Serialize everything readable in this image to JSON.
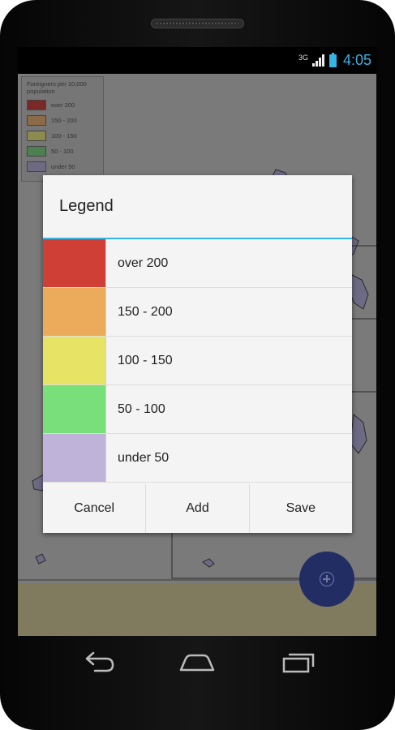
{
  "status_bar": {
    "network": "3G",
    "time": "4:05",
    "icons": [
      "signal-icon",
      "battery-icon"
    ],
    "accent_color": "#33b5e5"
  },
  "map_legend": {
    "title": "Foreigners per 10,000 population",
    "items": [
      {
        "label": "over 200",
        "color": "#7a2a26"
      },
      {
        "label": "150 - 200",
        "color": "#8a6a47"
      },
      {
        "label": "100 - 150",
        "color": "#8c8a4e"
      },
      {
        "label": "50 - 100",
        "color": "#4c8050"
      },
      {
        "label": "under 50",
        "color": "#6d6a83"
      }
    ]
  },
  "dialog": {
    "title": "Legend",
    "items": [
      {
        "label": "over 200",
        "color": "#cf3f35"
      },
      {
        "label": "150 - 200",
        "color": "#ecaa5b"
      },
      {
        "label": "100 - 150",
        "color": "#e7e465"
      },
      {
        "label": "50 - 100",
        "color": "#78df7b"
      },
      {
        "label": "under 50",
        "color": "#bfb3da"
      }
    ],
    "buttons": {
      "cancel": "Cancel",
      "add": "Add",
      "save": "Save"
    }
  },
  "fab": {
    "icon": "add-circle-icon",
    "color": "#222d63"
  },
  "navigation": {
    "back_icon": "back-icon",
    "home_icon": "home-icon",
    "recent_icon": "recent-apps-icon"
  }
}
